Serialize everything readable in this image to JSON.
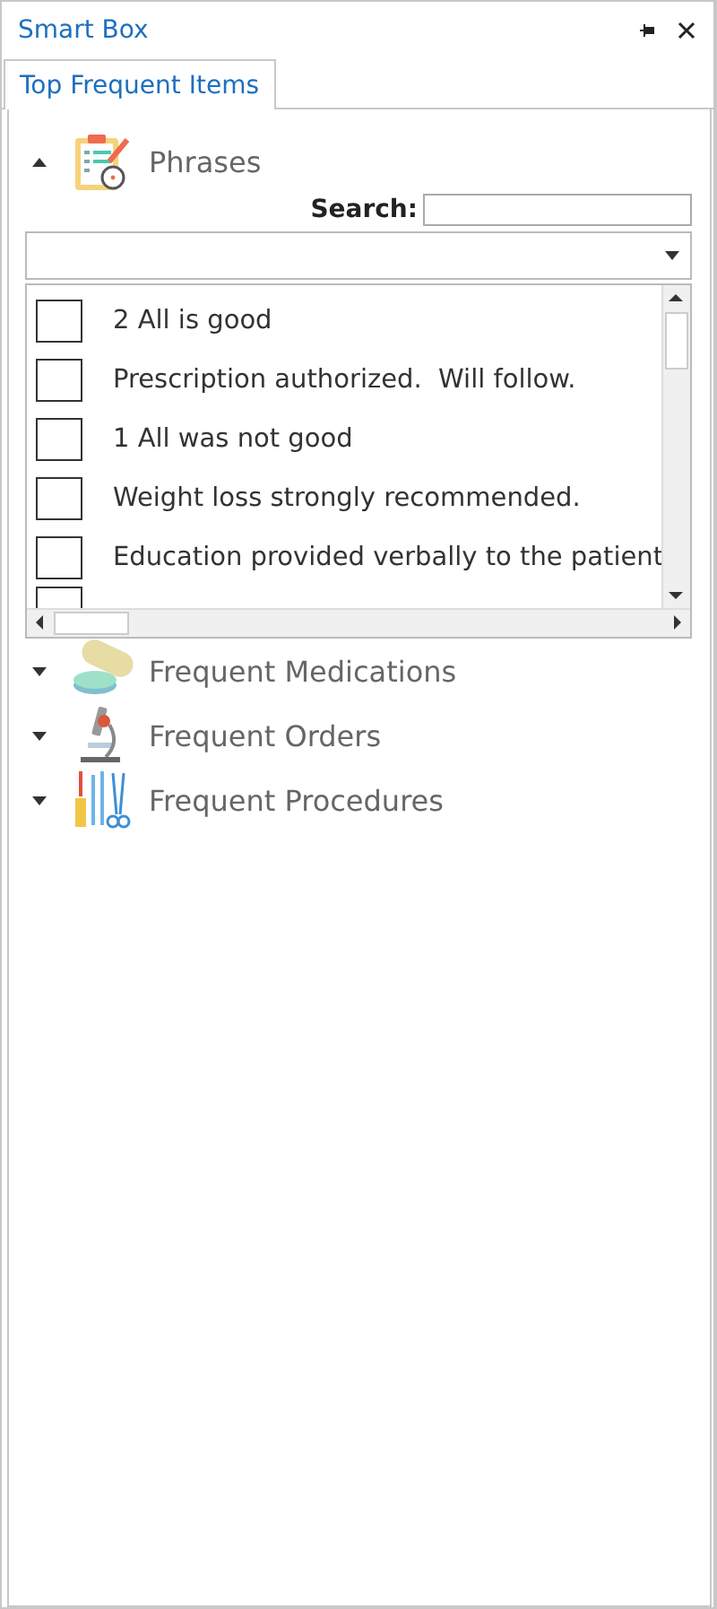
{
  "window": {
    "title": "Smart Box"
  },
  "tabs": [
    {
      "label": "Top Frequent Items",
      "selected": true
    }
  ],
  "sections": [
    {
      "kind": "phrases",
      "label": "Phrases",
      "expanded": true,
      "search_label": "Search:",
      "items": [
        {
          "text": "2 All is good",
          "checked": false
        },
        {
          "text": "Prescription authorized.  Will follow.",
          "checked": false
        },
        {
          "text": "1 All was not good",
          "checked": false
        },
        {
          "text": "Weight loss strongly recommended.",
          "checked": false
        },
        {
          "text": "Education provided verbally to the patient",
          "checked": false
        },
        {
          "checked": false
        }
      ]
    },
    {
      "kind": "medications",
      "label": "Frequent Medications",
      "expanded": false
    },
    {
      "kind": "orders",
      "label": "Frequent Orders",
      "expanded": false
    },
    {
      "kind": "procedures",
      "label": "Frequent Procedures",
      "expanded": false
    }
  ]
}
